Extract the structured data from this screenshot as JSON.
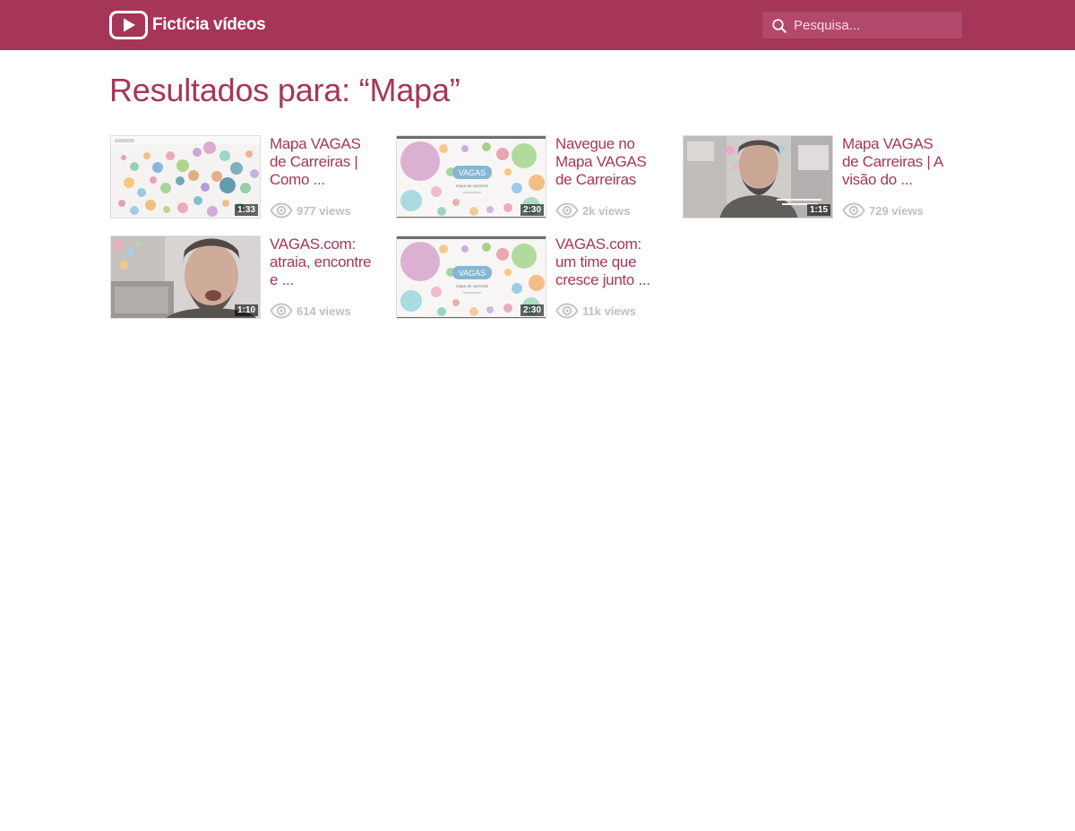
{
  "header": {
    "app_name": "Fictícia vídeos",
    "search": {
      "placeholder": "Pesquisa...",
      "value": ""
    }
  },
  "results": {
    "title": "Resultados para: “Mapa”",
    "videos": [
      {
        "title": "Mapa VAGAS de Carreiras | Como ...",
        "duration": "1:33",
        "views": "977 views"
      },
      {
        "title": "Navegue no Mapa VAGAS de Carreiras",
        "duration": "2:30",
        "views": "2k views"
      },
      {
        "title": "Mapa VAGAS de Carreiras | A visão do ...",
        "duration": "1:15",
        "views": "729 views"
      },
      {
        "title": "VAGAS.com: atraia, encontre e ...",
        "duration": "1:10",
        "views": "614 views"
      },
      {
        "title": "VAGAS.com: um time que cresce junto ...",
        "duration": "2:30",
        "views": "11k views"
      }
    ]
  },
  "thumbnail_texts": {
    "brand": "VAGAS",
    "tagline": "mapa de carreiras"
  },
  "colors": {
    "brand": "#a63657",
    "views_text": "#bfbfbf"
  },
  "icons": [
    "play-logo-icon",
    "search-icon",
    "eye-icon"
  ]
}
